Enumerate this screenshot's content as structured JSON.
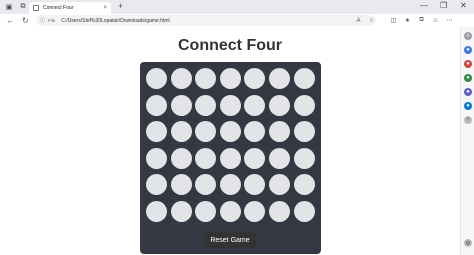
{
  "browser": {
    "tab_title": "Connect Four",
    "tab_close": "×",
    "new_tab": "+",
    "address_label": "File",
    "url": "C:/Users/Stef%20Lopatuk/Downloads/game.html",
    "window_controls": [
      "—",
      "❐",
      "✕"
    ],
    "nav": {
      "back": "←",
      "refresh": "↻"
    }
  },
  "page": {
    "title": "Connect Four",
    "reset_label": "Reset Game"
  },
  "board": {
    "rows": 6,
    "cols": 7,
    "empty_color": "#e3e4e8",
    "board_color": "#333842"
  },
  "colors": {
    "button_bg": "#333333",
    "heading": "#333333"
  }
}
